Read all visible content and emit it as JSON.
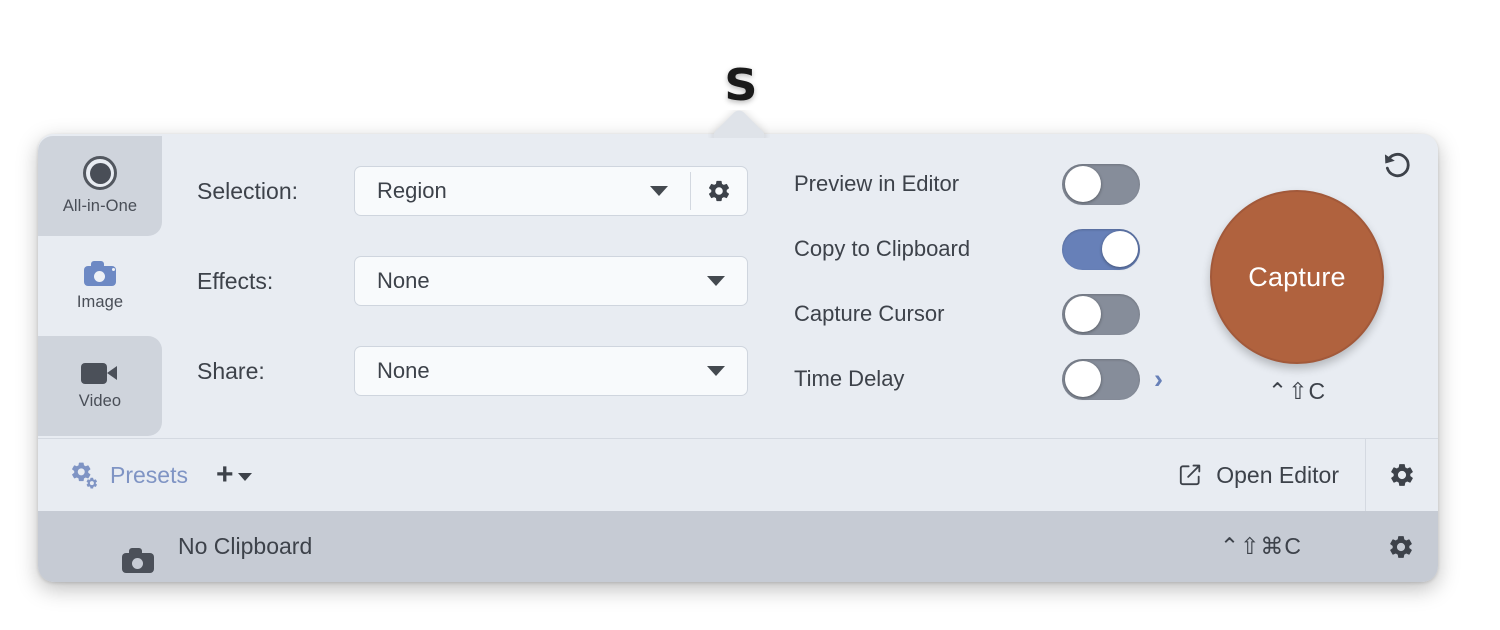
{
  "app": {
    "logo_glyph": "S"
  },
  "sidebar": {
    "items": [
      {
        "label": "All-in-One",
        "icon": "record-circle-icon",
        "selected": true
      },
      {
        "label": "Image",
        "icon": "camera-icon",
        "selected": false
      },
      {
        "label": "Video",
        "icon": "camcorder-icon",
        "selected": true
      }
    ]
  },
  "fields": [
    {
      "label": "Selection:",
      "value": "Region",
      "has_gear": true,
      "gear_icon": "gear-icon",
      "caret_icon": "chevron-down-icon"
    },
    {
      "label": "Effects:",
      "value": "None",
      "has_gear": false,
      "caret_icon": "chevron-down-icon"
    },
    {
      "label": "Share:",
      "value": "None",
      "has_gear": false,
      "caret_icon": "chevron-down-icon"
    }
  ],
  "toggles": [
    {
      "label": "Preview in Editor",
      "on": false,
      "has_chevron": false
    },
    {
      "label": "Copy to Clipboard",
      "on": true,
      "has_chevron": false
    },
    {
      "label": "Capture Cursor",
      "on": false,
      "has_chevron": false
    },
    {
      "label": "Time Delay",
      "on": false,
      "has_chevron": true,
      "chevron_icon": "chevron-right-icon"
    }
  ],
  "capture": {
    "button_label": "Capture",
    "shortcut": "⌃⇧C",
    "reset_icon": "undo-reset-icon",
    "button_color": "#b0623e"
  },
  "presets_bar": {
    "icon": "double-gear-icon",
    "label": "Presets",
    "add_glyph": "+",
    "add_caret_icon": "chevron-down-icon",
    "open_editor_label": "Open Editor",
    "open_editor_icon": "pencil-square-icon",
    "settings_icon": "gear-icon"
  },
  "status_bar": {
    "icon": "camera-icon",
    "text": "No Clipboard",
    "shortcut": "⌃⇧⌘C",
    "settings_icon": "gear-icon"
  },
  "colors": {
    "panel_bg": "#e8ecf2",
    "sidebar_selected": "#cfd4dc",
    "status_bg": "#c6cbd4",
    "accent_blue": "#6780b8",
    "presets_text": "#7f94c4",
    "capture_brown": "#b0623e",
    "text": "#3d424a"
  }
}
